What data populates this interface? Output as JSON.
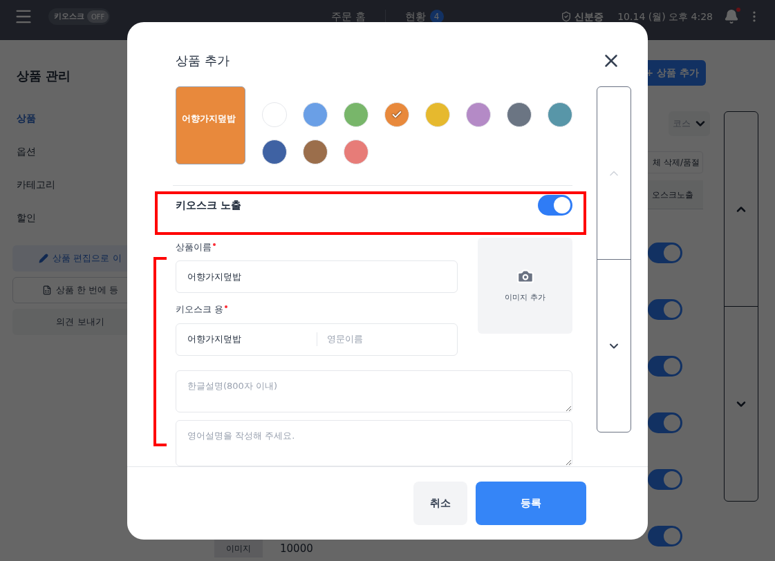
{
  "header": {
    "kiosk_toggle": {
      "label": "키오스크",
      "state": "OFF",
      "on": false
    },
    "nav": [
      {
        "label": "주문 홈"
      },
      {
        "label": "현황",
        "badge": "4"
      }
    ],
    "status": "신분증",
    "datetime": "10.14 (월) 오후 4:28",
    "notification_dot": true
  },
  "sidebar": {
    "title": "상품 관리",
    "items": [
      {
        "label": "상품",
        "selected": true
      },
      {
        "label": "옵션",
        "selected": false
      },
      {
        "label": "카테고리",
        "selected": false
      },
      {
        "label": "할인",
        "selected": false
      }
    ],
    "buttons": [
      {
        "kind": "edit",
        "label": "상품 편집으로 이"
      },
      {
        "kind": "bulk",
        "label": "상품 한 번에 등"
      },
      {
        "kind": "feedback",
        "label": "의견 보내기"
      }
    ]
  },
  "main": {
    "add_button": "+ 상품 추가",
    "filter": "코스",
    "action_button": "체 삭제/품절",
    "column_header": "오스크노출",
    "rows": [
      {
        "on": true
      },
      {
        "on": true
      },
      {
        "on": true
      },
      {
        "on": true
      },
      {
        "on": true
      },
      {
        "on": true,
        "image_label": "이미지",
        "price": "10000"
      }
    ]
  },
  "modal": {
    "title": "상품 추가",
    "preview_label": "어향가지덮밥",
    "swatches": [
      {
        "color": "#ffffff",
        "selected": false
      },
      {
        "color": "#6a9fe6",
        "selected": false
      },
      {
        "color": "#78b66a",
        "selected": false
      },
      {
        "color": "#e8893c",
        "selected": true
      },
      {
        "color": "#e6b92e",
        "selected": false
      },
      {
        "color": "#b48ac6",
        "selected": false
      },
      {
        "color": "#6b7583",
        "selected": false
      },
      {
        "color": "#5896a8",
        "selected": false
      },
      {
        "color": "#3f62a3",
        "selected": false
      },
      {
        "color": "#9b6e4b",
        "selected": false
      },
      {
        "color": "#e77c78",
        "selected": false
      }
    ],
    "kiosk_exposure": {
      "label": "키오스크 노출",
      "on": true
    },
    "name_field": {
      "label": "상품이름",
      "required": true,
      "value": "어향가지덮밥"
    },
    "kiosk_field": {
      "label": "키오스크 용",
      "required": true,
      "value": "어향가지덮밥",
      "placeholder": "영문이름"
    },
    "image_button": "이미지 추가",
    "desc_ko": {
      "placeholder": "한글설명(800자 이내)"
    },
    "desc_en": {
      "placeholder": "영어설명을 작성해 주세요."
    },
    "buttons": [
      {
        "kind": "secondary",
        "label": "취소"
      },
      {
        "kind": "primary",
        "label": "등록"
      }
    ]
  }
}
